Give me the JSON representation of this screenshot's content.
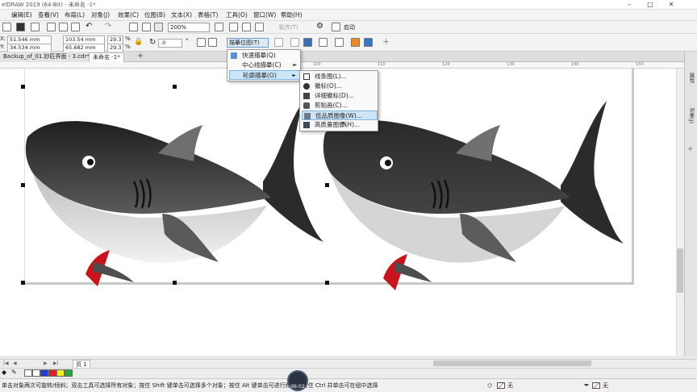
{
  "titlebar": {
    "title": "elDRAW 2019 (64-Bit) - 未命名 -1*",
    "minimize": "–",
    "maximize": "□",
    "close": "✕"
  },
  "menubar": {
    "items": [
      "编辑(E)",
      "查看(V)",
      "布局(L)",
      "对象(J)",
      "效果(C)",
      "位图(B)",
      "文本(X)",
      "表格(T)",
      "工具(O)",
      "窗口(W)",
      "帮助(H)"
    ]
  },
  "toolbar1": {
    "zoom": "200%",
    "snap_label": "贴齐(T)",
    "launch_label": "启动"
  },
  "toolbar2": {
    "x_label": "X:",
    "x_value": "51.546 mm",
    "y_label": "Y:",
    "y_value": "34.534 mm",
    "w_value": "103.54 mm",
    "h_value": "65.682 mm",
    "scale_x": "29.3",
    "scale_y": "29.3",
    "pct": "%",
    "angle": ".0",
    "angle_unit": "°",
    "trace_button": "描摹位图(T)"
  },
  "doctabs": {
    "tabs": [
      "Backup_of_01.妙匠界面 - 3.cdr*",
      "未命名 -1*"
    ],
    "add": "+"
  },
  "ruler": {
    "ticks": [
      "100",
      "110",
      "120",
      "130",
      "140",
      "150"
    ]
  },
  "trace_menu": {
    "items": [
      {
        "label": "快速描摹(Q)",
        "arrow": ""
      },
      {
        "label": "中心线描摹(C)",
        "arrow": "►"
      },
      {
        "label": "轮廓描摹(O)",
        "arrow": "►"
      }
    ]
  },
  "outline_submenu": {
    "items": [
      "线条图(L)...",
      "徽标(O)...",
      "详细徽标(D)...",
      "剪贴画(C)...",
      "低品质图像(W)...",
      "高质量图像(H)..."
    ],
    "highlighted_index": 4
  },
  "docker": {
    "tabs": [
      "属性",
      "对象(J)"
    ]
  },
  "pagenav": {
    "page_label": "页 1",
    "nav": [
      "|◀",
      "◀",
      "▶",
      "▶|"
    ]
  },
  "palette": {
    "colors": [
      "#ffffff",
      "#1f3fd1",
      "#e41f1f",
      "#f6ef1c",
      "#2aa63a"
    ]
  },
  "statusbar": {
    "text": "单击对象两次可旋转/倾斜；双击工具可选择所有对象；按住 Shift 键单击可选择多个对象；按住 Alt 键单击可进行挖掘；按住 Ctrl 并单击可在组中选择",
    "fill_label": "无",
    "outline_label": "无",
    "timer": "06:02"
  },
  "colors": {
    "shark_dark": "#2c2c2c",
    "shark_mid": "#7a7a7a",
    "shark_light": "#d7d7d7",
    "mouth": "#c8141b",
    "highlight": "#cde6f7"
  }
}
